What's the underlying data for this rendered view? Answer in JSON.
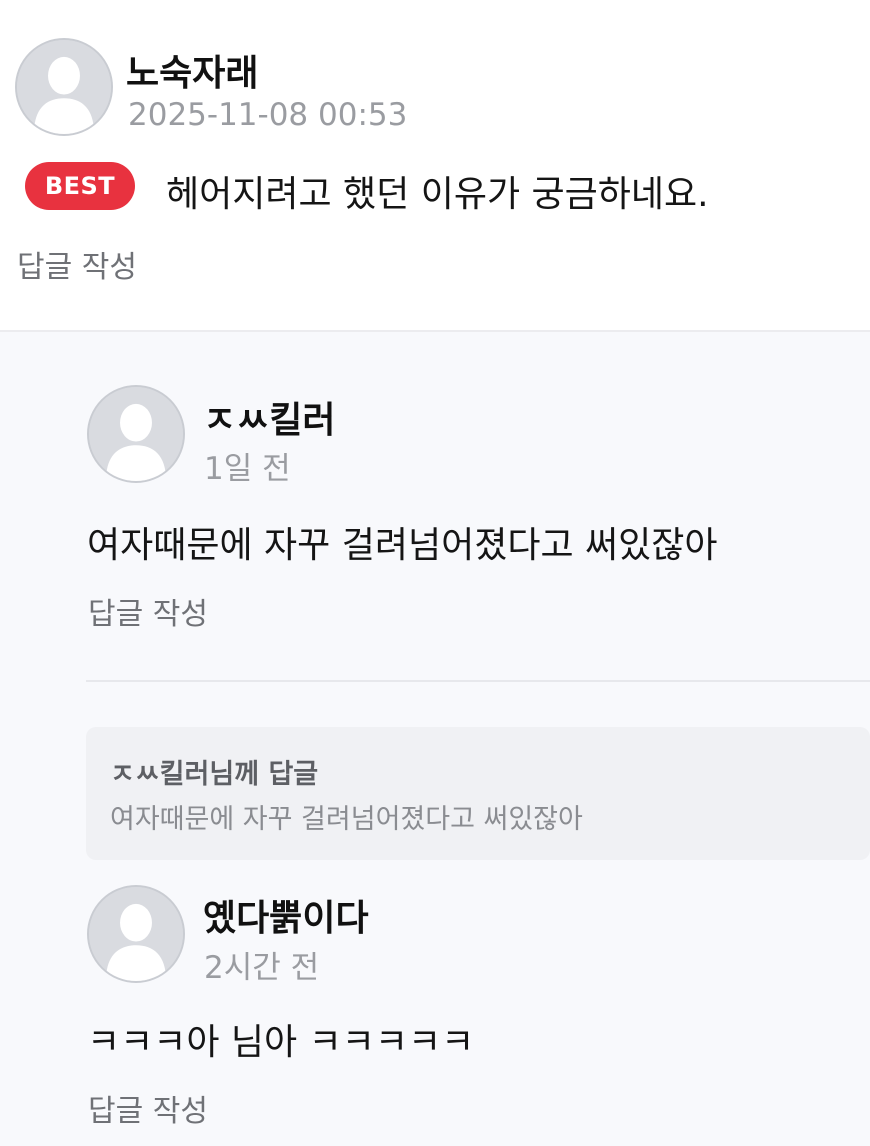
{
  "comment": {
    "author": "노숙자래",
    "timestamp": "2025-11-08 00:53",
    "badge": "BEST",
    "text": "헤어지려고 했던 이유가 궁금하네요.",
    "reply_label": "답글 작성"
  },
  "replies": [
    {
      "author": "ㅈㅆ킬러",
      "timestamp": "1일 전",
      "text": "여자때문에 자꾸 걸려넘어졌다고 써있잖아",
      "reply_label": "답글 작성"
    },
    {
      "quote_title": "ㅈㅆ킬러님께 답글",
      "quote_text": "여자때문에 자꾸 걸려넘어졌다고 써있잖아",
      "author": "옜다뿕이다",
      "timestamp": "2시간 전",
      "text": "ㅋㅋㅋ아 님아 ㅋㅋㅋㅋㅋ",
      "reply_label": "답글 작성"
    }
  ],
  "colors": {
    "badge_bg": "#e8323f",
    "reply_area_bg": "#f8f9fc",
    "meta_text": "#9a9ca1"
  },
  "icons": {
    "avatar": "default-user-avatar-icon"
  }
}
